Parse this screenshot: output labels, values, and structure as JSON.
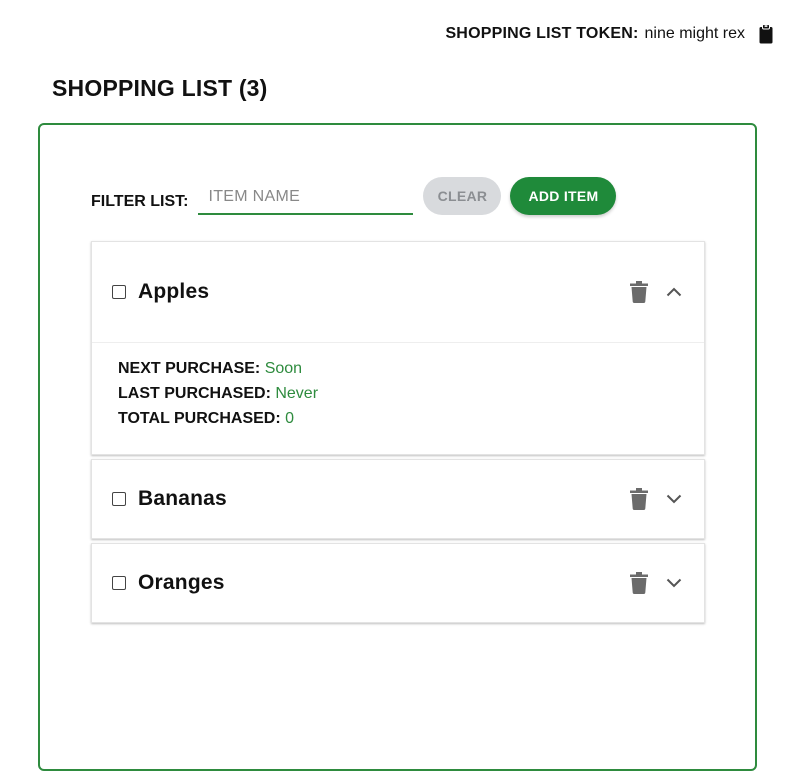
{
  "header": {
    "token_label": "SHOPPING LIST TOKEN:",
    "token_value": "nine might rex",
    "copy_icon": "clipboard-icon"
  },
  "page": {
    "title": "SHOPPING LIST (3)"
  },
  "filter": {
    "label": "FILTER LIST:",
    "placeholder": "ITEM NAME",
    "value": "",
    "clear_label": "CLEAR",
    "add_label": "ADD ITEM"
  },
  "items": [
    {
      "name": "Apples",
      "expanded": true,
      "next_purchase_label": "NEXT PURCHASE:",
      "next_purchase": "Soon",
      "last_purchased_label": "LAST PURCHASED:",
      "last_purchased": "Never",
      "total_purchased_label": "TOTAL PURCHASED:",
      "total_purchased": "0"
    },
    {
      "name": "Bananas",
      "expanded": false
    },
    {
      "name": "Oranges",
      "expanded": false
    }
  ],
  "colors": {
    "accent": "#2e8b3e",
    "add_button": "#1f8a3a",
    "clear_button": "#d8dadd",
    "icon_gray": "#6b6b6b"
  }
}
